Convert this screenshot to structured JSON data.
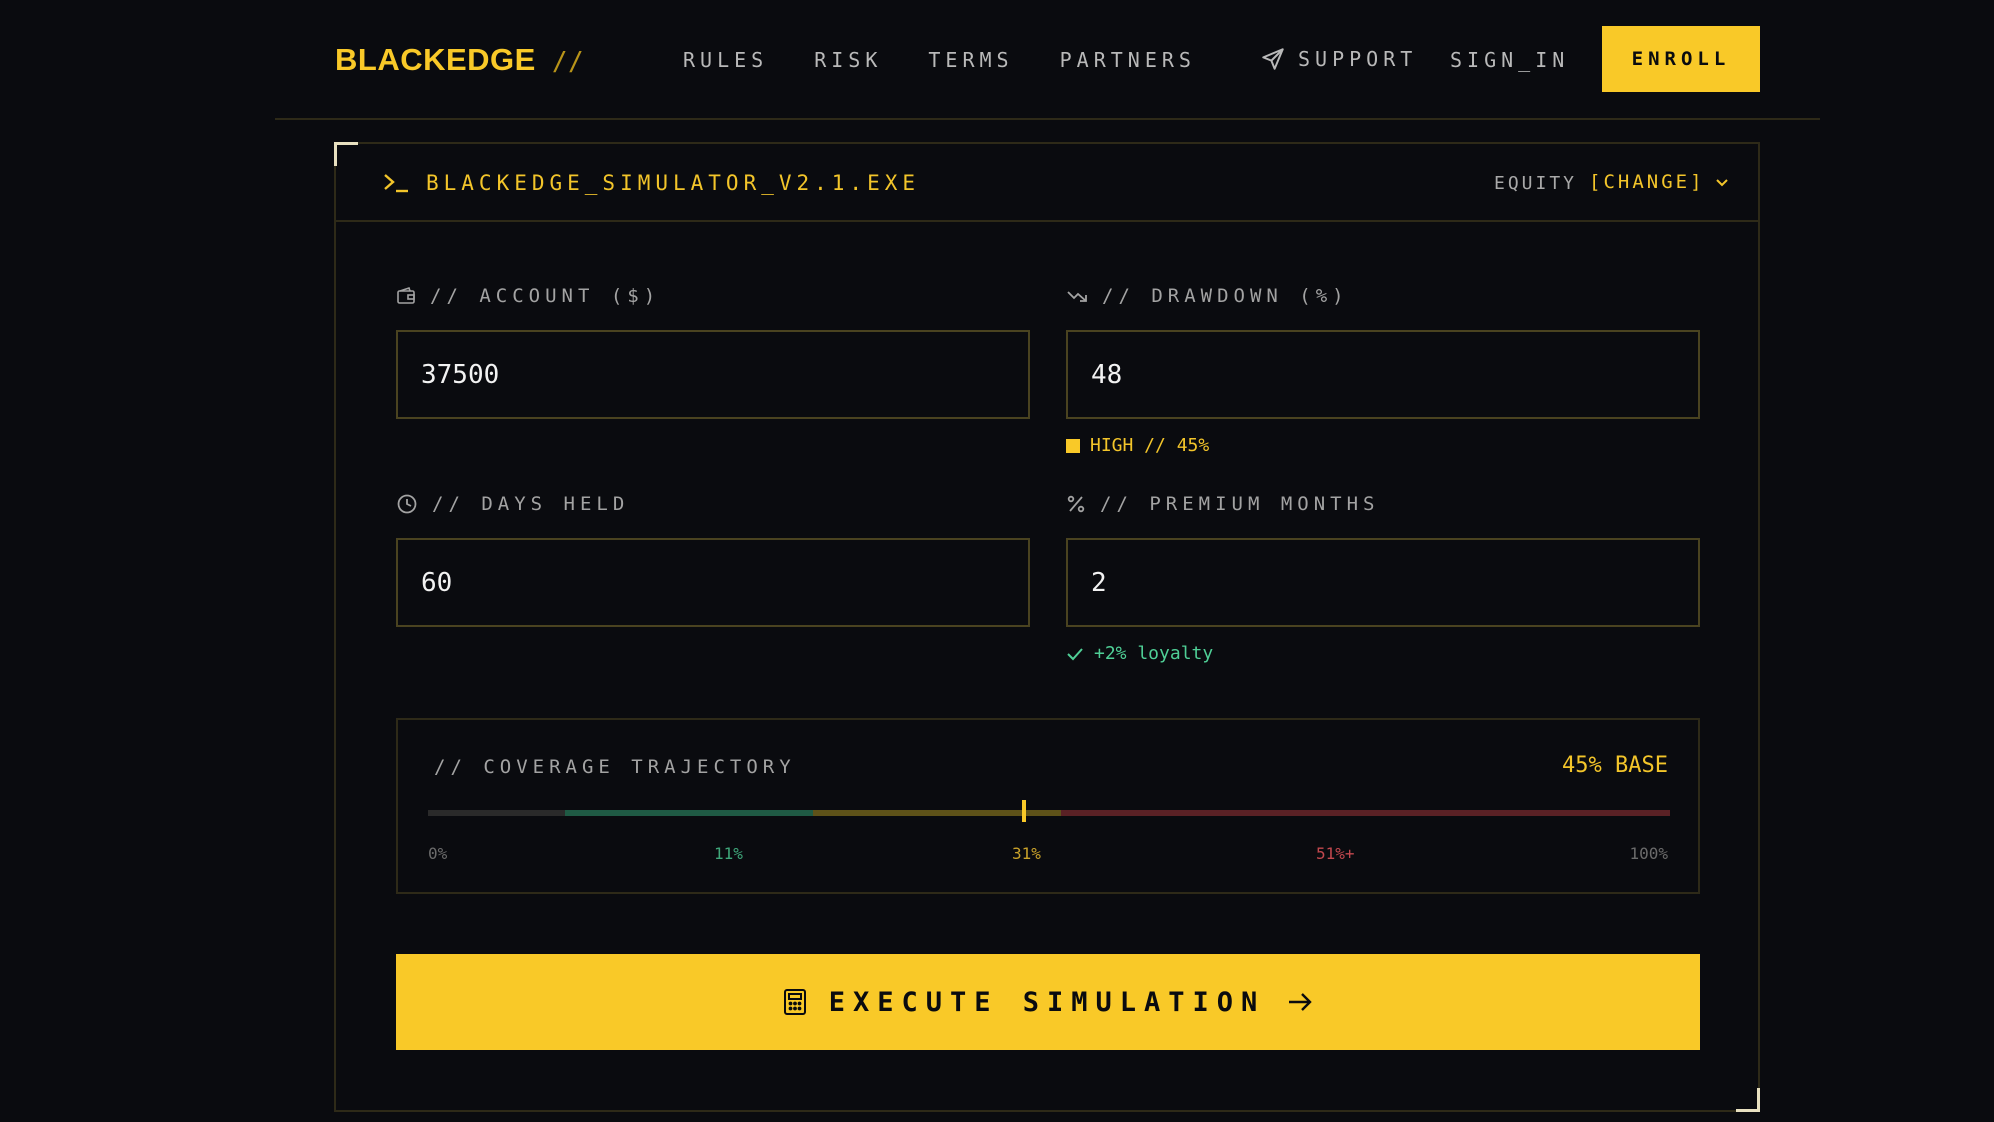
{
  "nav": {
    "brand": "BLACKEDGE",
    "brand_suffix": "//",
    "links": [
      "RULES",
      "RISK",
      "TERMS",
      "PARTNERS"
    ],
    "support": "SUPPORT",
    "sign_in": "SIGN_IN",
    "enroll": "ENROLL"
  },
  "panel": {
    "title": "BLACKEDGE_SIMULATOR_V2.1.EXE",
    "mode_label": "EQUITY",
    "mode_change": "[CHANGE]"
  },
  "fields": {
    "account": {
      "label": "// ACCOUNT ($)",
      "value": "37500"
    },
    "drawdown": {
      "label": "// DRAWDOWN (%)",
      "value": "48",
      "hint": "HIGH // 45%"
    },
    "days_held": {
      "label": "// DAYS HELD",
      "value": "60"
    },
    "premium_months": {
      "label": "// PREMIUM MONTHS",
      "value": "2",
      "hint": "+2% loyalty"
    }
  },
  "trajectory": {
    "label": "// COVERAGE TRAJECTORY",
    "base": "45% BASE",
    "marker_percent": 48,
    "ticks": [
      "0%",
      "11%",
      "31%",
      "51%+",
      "100%"
    ],
    "tick_colors": [
      "#6b6b6b",
      "#3fa77a",
      "#c9a22a",
      "#c2484e",
      "#6b6b6b"
    ]
  },
  "execute": {
    "label": "EXECUTE SIMULATION"
  },
  "colors": {
    "accent": "#f9c928",
    "background": "#0a0b0f",
    "border": "#2e2a18",
    "success": "#4fcf96",
    "danger": "#c2484e"
  }
}
